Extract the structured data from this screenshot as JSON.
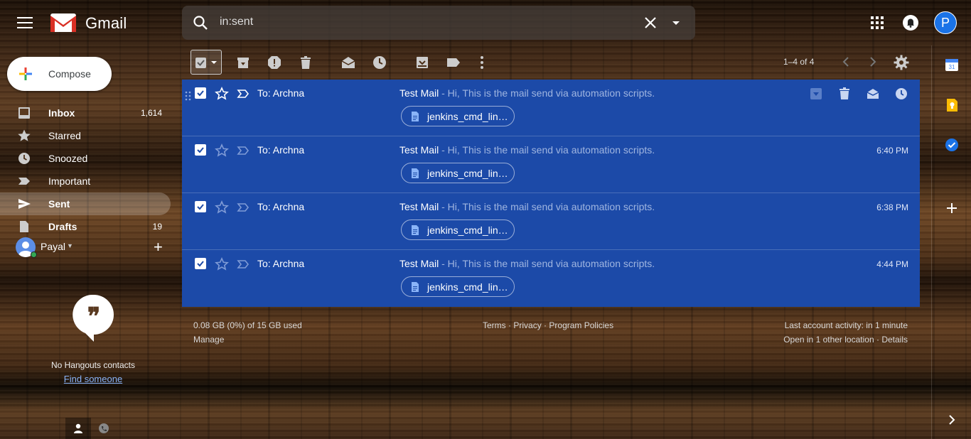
{
  "app": {
    "logo_text": "Gmail"
  },
  "search": {
    "query": "in:sent"
  },
  "account": {
    "avatar_initial": "P"
  },
  "compose": {
    "label": "Compose"
  },
  "sidebar": {
    "items": [
      {
        "label": "Inbox",
        "count": "1,614",
        "icon": "inbox-icon"
      },
      {
        "label": "Starred",
        "count": "",
        "icon": "star-icon"
      },
      {
        "label": "Snoozed",
        "count": "",
        "icon": "clock-icon"
      },
      {
        "label": "Important",
        "count": "",
        "icon": "important-icon"
      },
      {
        "label": "Sent",
        "count": "",
        "icon": "send-icon"
      },
      {
        "label": "Drafts",
        "count": "19",
        "icon": "draft-icon"
      }
    ],
    "user": {
      "name": "Payal"
    }
  },
  "hangouts": {
    "empty_text": "No Hangouts contacts",
    "find_link": "Find someone"
  },
  "toolbar": {
    "pager": "1–4 of 4"
  },
  "messages": [
    {
      "to": "To: Archna",
      "subject": "Test Mail",
      "snippet": " - Hi, This is the mail send via automation scripts.",
      "time": "",
      "attachment": "jenkins_cmd_lin…"
    },
    {
      "to": "To: Archna",
      "subject": "Test Mail",
      "snippet": " - Hi, This is the mail send via automation scripts.",
      "time": "6:40 PM",
      "attachment": "jenkins_cmd_lin…"
    },
    {
      "to": "To: Archna",
      "subject": "Test Mail",
      "snippet": " - Hi, This is the mail send via automation scripts.",
      "time": "6:38 PM",
      "attachment": "jenkins_cmd_lin…"
    },
    {
      "to": "To: Archna",
      "subject": "Test Mail",
      "snippet": " - Hi, This is the mail send via automation scripts.",
      "time": "4:44 PM",
      "attachment": "jenkins_cmd_lin…"
    }
  ],
  "footer": {
    "storage": "0.08 GB (0%) of 15 GB used",
    "manage": "Manage",
    "terms": "Terms",
    "privacy": "Privacy",
    "policies": "Program Policies",
    "sep": "·",
    "activity": "Last account activity: in 1 minute",
    "location": "Open in 1 other location",
    "details": "Details"
  },
  "colors": {
    "row_selected": "#1c4aa8",
    "accent": "#1a73e8"
  }
}
